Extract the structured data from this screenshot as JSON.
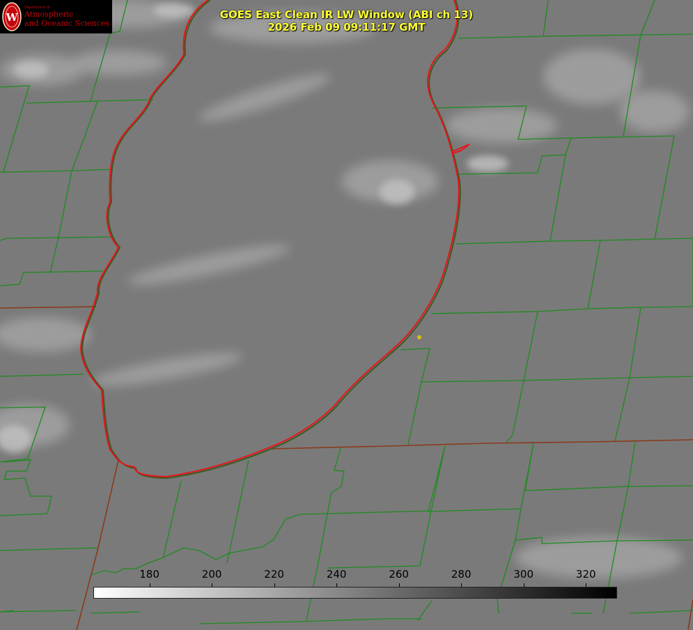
{
  "title": {
    "line1": "GOES East Clean IR LW Window (ABI ch 13)",
    "line2": "2026 Feb 09 09:11:17 GMT"
  },
  "logo": {
    "small": "Department of",
    "line1": "Atmospheric",
    "line2": "and Oceanic Sciences",
    "seal_letter": "W"
  },
  "colorbar": {
    "min": 162,
    "max": 330,
    "ticks": [
      "180",
      "200",
      "220",
      "240",
      "260",
      "280",
      "300",
      "320"
    ],
    "colors": {
      "low": "#ffffff",
      "high": "#000000"
    }
  },
  "colors": {
    "background": "#7a7a7a",
    "lake_outline": "#e8141c",
    "county_lines": "#1f8a1f",
    "state_lines": "#8b3a1a",
    "title_text": "#ffff33",
    "marker": "#d4c20a"
  }
}
